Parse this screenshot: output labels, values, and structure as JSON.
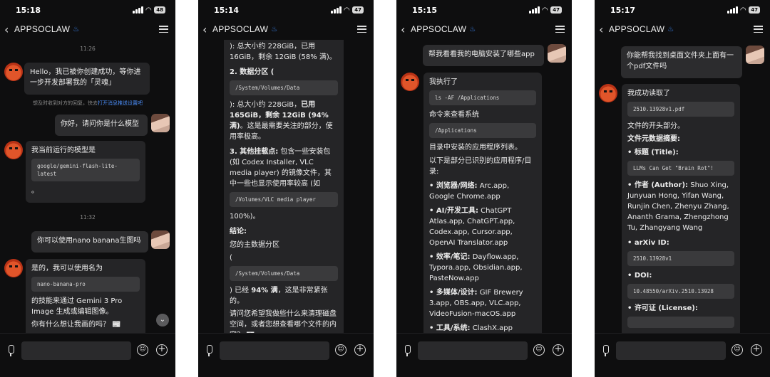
{
  "app": {
    "title": "APPSOCLAW",
    "title_icon": "flame-icon"
  },
  "phones": [
    {
      "time": "15:18",
      "battery": "48"
    },
    {
      "time": "15:14",
      "battery": "47"
    },
    {
      "time": "15:15",
      "battery": "47"
    },
    {
      "time": "15:17",
      "battery": "47"
    }
  ],
  "p1": {
    "ts1": "11:26",
    "bot1": "Hello，我已被你创建成功，等你进一步开发部署我的「灵魂」",
    "hint_pre": "想及时收到对方的回复，快去",
    "hint_link": "打开消息推送设置吧",
    "user1": "你好，请问你是什么模型",
    "bot2_intro": "我当前运行的模型是",
    "bot2_code": "google/gemini-flash-lite-latest",
    "bot2_end": "。",
    "ts2": "11:32",
    "user2": "你可以使用nano banana生图吗",
    "bot3_intro": "是的，我可以使用名为",
    "bot3_code": "nano-banana-pro",
    "bot3_body": "的技能来通过 Gemini 3 Pro Image 生成或编辑图像。",
    "bot3_end": "你有什么想让我画的吗？ 📰"
  },
  "p2": {
    "line1": "): 总大小约 228GiB，已用 16GiB，剩余 12GiB (58% 满)。",
    "item2_title": "2. 数据分区 (",
    "code1": "/System/Volumes/Data",
    "line2_a": "): 总大小约 228GiB，",
    "line2_b": "已用 165GiB，剩余 12GiB (94% 满)",
    "line2_c": "。这是最需要关注的部分，使用率极高。",
    "item3_title": "3. 其他挂载点:",
    "item3_body": " 包含一些安装包 (如 Codex Installer, VLC media player) 的镜像文件，其中一些也显示使用率较高 (如",
    "code2": "/Volumes/VLC media player",
    "line3": "100%)。",
    "conclusion": "结论:",
    "line4": "您的主数据分区",
    "paren": "(",
    "code3": "/System/Volumes/Data",
    "line5_a": ") 已经 ",
    "line5_b": "94% 满",
    "line5_c": "，这是非常紧张的。",
    "line6": "请问您希望我做些什么来清理磁盘空间，或者您想查看哪个文件的内容？ 📰"
  },
  "p3": {
    "user1": "帮我看看我的电脑安装了哪些app",
    "intro": "我执行了",
    "code1": "ls -AF /Applications",
    "mid": "命令来查看系统",
    "code2": "/Applications",
    "mid2": "目录中安装的应用程序列表。",
    "lead": "以下是部分已识别的应用程序/目录:",
    "c1_title": "• 浏览器/网络:",
    "c1_body": " Arc.app, Google Chrome.app",
    "c2_title": "• AI/开发工具:",
    "c2_body": " ChatGPT Atlas.app, ChatGPT.app, Codex.app, Cursor.app, OpenAI Translator.app",
    "c3_title": "• 效率/笔记:",
    "c3_body": " Dayflow.app, Typora.app, Obsidian.app, PasteNow.app",
    "c4_title": "• 多媒体/设计:",
    "c4_body": " GIF Brewery 3.app, OBS.app, VLC.app, VideoFusion-macOS.app",
    "c5_title": "• 工具/系统:",
    "c5_body": " ClashX.app"
  },
  "p4": {
    "user1": "你能帮我找到桌面文件夹上面有一个pdf文件吗",
    "intro": "我成功读取了",
    "code1": "2510.13928v1.pdf",
    "line1": "文件的开头部分。",
    "meta": "文件元数据摘要:",
    "t_title": "• 标题 (Title):",
    "t_code": "LLMs Can Get \"Brain Rot\"!",
    "a_title": "• 作者 (Author):",
    "a_body": " Shuo Xing, Junyuan Hong, Yifan Wang, Runjin Chen, Zhenyu Zhang, Ananth Grama, Zhengzhong Tu, Zhangyang Wang",
    "x_title": "• arXiv ID:",
    "x_code": "2510.13928v1",
    "d_title": "• DOI:",
    "d_code": "10.48550/arXiv.2510.13928",
    "l_title": "• 许可证 (License):"
  }
}
